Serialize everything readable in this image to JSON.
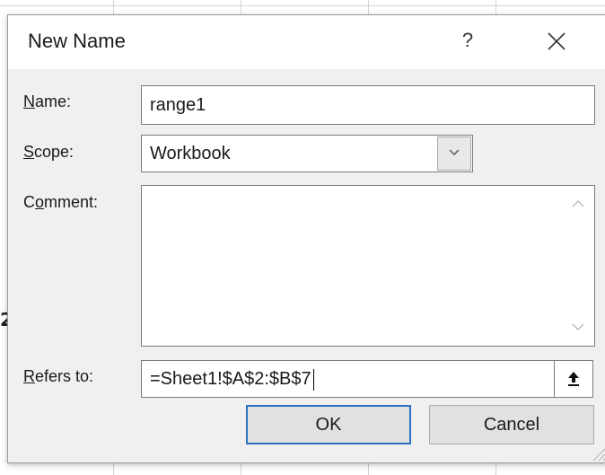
{
  "dialog": {
    "title": "New Name",
    "help_label": "?",
    "close_icon": "close-x-icon"
  },
  "form": {
    "name_label_u": "N",
    "name_label_rest": "ame:",
    "name_value": "range1",
    "scope_label_u": "S",
    "scope_label_rest": "cope:",
    "scope_value": "Workbook",
    "comment_label_a": "C",
    "comment_label_u": "o",
    "comment_label_rest": "mment:",
    "comment_value": "",
    "refers_label_u": "R",
    "refers_label_rest": "efers to:",
    "refers_value": "=Sheet1!$A$2:$B$7"
  },
  "buttons": {
    "ok_label": "OK",
    "cancel_label": "Cancel"
  },
  "colors": {
    "dialog_bg": "#f0f0f0",
    "titlebar_bg": "#ffffff",
    "default_button_border": "#2a73c5",
    "field_border": "#7a7a7a"
  }
}
